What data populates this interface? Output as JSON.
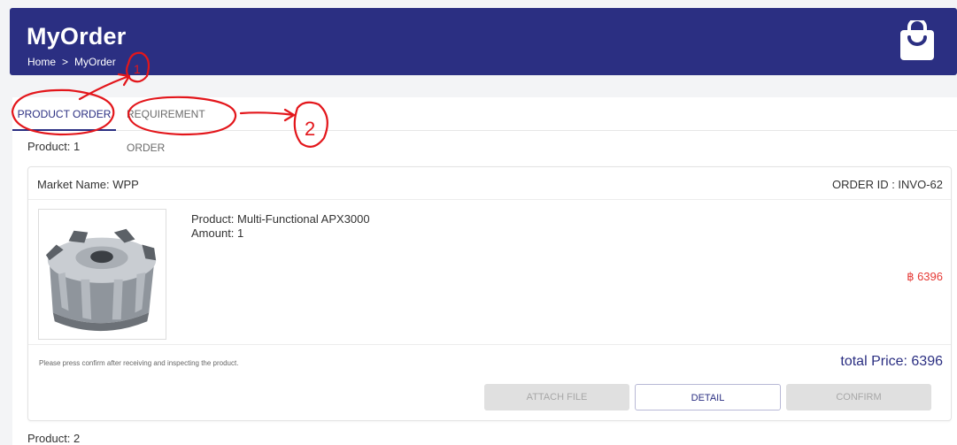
{
  "header": {
    "title": "MyOrder",
    "breadcrumb": {
      "home": "Home",
      "separator": ">",
      "current": "MyOrder"
    },
    "icon": "shopping-bag-icon"
  },
  "tabs": [
    {
      "label": "PRODUCT ORDER",
      "active": true
    },
    {
      "label": "REQUIREMENT ORDER",
      "active": false
    }
  ],
  "products": [
    {
      "heading": "Product: 1",
      "market_name": "Market Name: WPP",
      "order_id": "ORDER ID : INVO-62",
      "product_line": "Product: Multi-Functional APX3000",
      "amount_line": "Amount: 1",
      "price": "฿ 6396",
      "note": "Please press confirm after receiving and inspecting the product.",
      "total": "total Price: 6396",
      "buttons": {
        "attach": "ATTACH FILE",
        "detail": "DETAIL",
        "confirm": "CONFIRM"
      }
    },
    {
      "heading": "Product: 2"
    }
  ],
  "annotations": {
    "mark_1": "1",
    "mark_2": "2"
  },
  "colors": {
    "primary": "#2b2f82",
    "price": "#e53935",
    "annotation": "#e3161b"
  }
}
